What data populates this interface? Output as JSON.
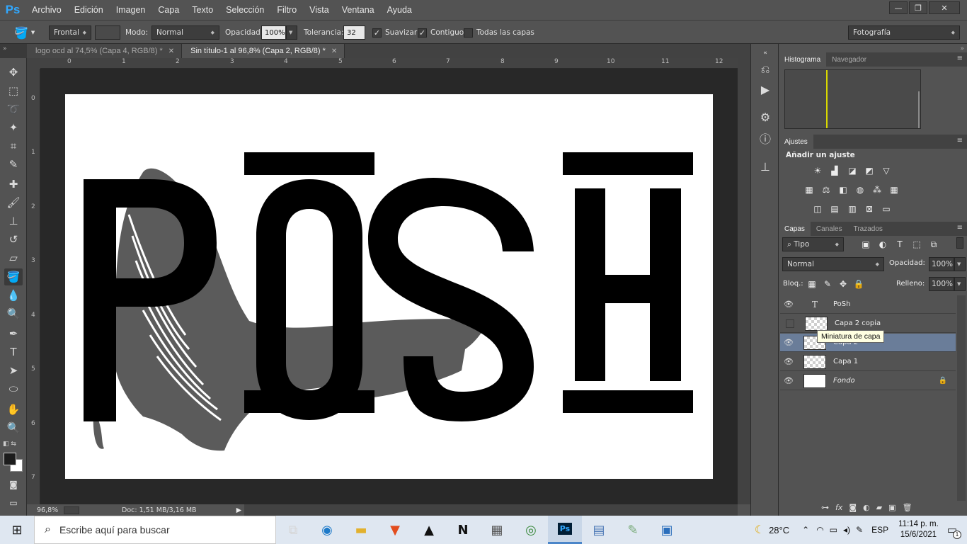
{
  "app": {
    "logo": "Ps"
  },
  "menu": [
    "Archivo",
    "Edición",
    "Imagen",
    "Capa",
    "Texto",
    "Selección",
    "Filtro",
    "Vista",
    "Ventana",
    "Ayuda"
  ],
  "window_controls": {
    "minimize": "—",
    "restore": "❐",
    "close": "✕"
  },
  "options": {
    "fill_source": "Frontal",
    "mode_label": "Modo:",
    "mode_value": "Normal",
    "opacity_label": "Opacidad:",
    "opacity_value": "100%",
    "tolerance_label": "Tolerancia:",
    "tolerance_value": "32",
    "smooth_label": "Suavizar",
    "contiguous_label": "Contiguo",
    "all_layers_label": "Todas las capas",
    "workspace": "Fotografía"
  },
  "tabs": [
    {
      "label": "logo ocd al 74,5% (Capa 4, RGB/8) *",
      "active": false
    },
    {
      "label": "Sin título-1 al 96,8% (Capa 2, RGB/8) *",
      "active": true
    }
  ],
  "ruler_h": [
    "0",
    "1",
    "2",
    "3",
    "4",
    "5",
    "6",
    "7",
    "8",
    "9",
    "10",
    "11",
    "12"
  ],
  "ruler_v": [
    "0",
    "1",
    "2",
    "3",
    "4",
    "5",
    "6",
    "7"
  ],
  "status": {
    "zoom": "96,8%",
    "doc": "Doc: 1,51 MB/3,16 MB"
  },
  "canvas_text": {
    "letters": [
      "P",
      "O",
      "S",
      "H"
    ]
  },
  "panels": {
    "histogram_tab": "Histograma",
    "navigator_tab": "Navegador",
    "adjustments_tab": "Ajustes",
    "add_adjustment": "Añadir un ajuste",
    "layers_tab": "Capas",
    "channels_tab": "Canales",
    "paths_tab": "Trazados",
    "filter_kind": "Tipo",
    "blend_mode": "Normal",
    "opacity_label": "Opacidad:",
    "opacity_value": "100%",
    "lock_label": "Bloq.:",
    "fill_label": "Relleno:",
    "fill_value": "100%"
  },
  "layers": [
    {
      "name": "PoSh",
      "type": "text",
      "visible": true
    },
    {
      "name": "Capa 2 copia",
      "type": "raster",
      "visible": false
    },
    {
      "name": "Capa 2",
      "type": "raster",
      "visible": true,
      "selected": true
    },
    {
      "name": "Capa 1",
      "type": "raster",
      "visible": true
    },
    {
      "name": "Fondo",
      "type": "background",
      "visible": true,
      "locked": true
    }
  ],
  "tooltip": "Miniatura de capa",
  "taskbar": {
    "search_placeholder": "Escribe aquí para buscar",
    "weather": "28°C",
    "language": "ESP",
    "time": "11:14 p. m.",
    "date": "15/6/2021",
    "notifications": "1"
  },
  "colors": {
    "accent_ps": "#31a8ff",
    "selected_layer": "#6a7d99"
  }
}
